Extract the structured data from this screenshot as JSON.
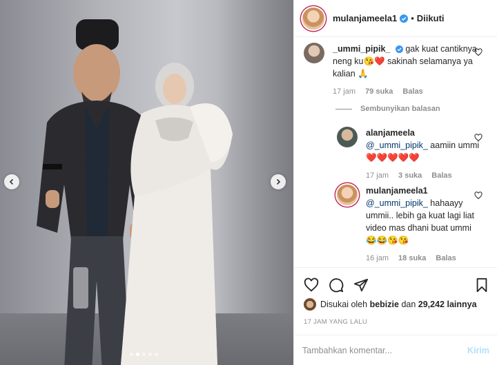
{
  "post": {
    "author": "mulanjameela1",
    "separator": "•",
    "follow_status": "Diikuti"
  },
  "comments": [
    {
      "username": "_ummi_pipik_",
      "text": "gak kuat cantiknya neng ku😘❤️ sakinah selamanya ya kalian 🙏",
      "time": "17 jam",
      "likes": "79 suka",
      "reply": "Balas"
    }
  ],
  "hide_replies": "Sembunyikan balasan",
  "replies": [
    {
      "username": "alanjameela",
      "mention": "@_ummi_pipik_",
      "text": " aamiin ummi ❤️❤️❤️❤️❤️",
      "time": "17 jam",
      "likes": "3 suka",
      "reply": "Balas"
    },
    {
      "username": "mulanjameela1",
      "mention": "@_ummi_pipik_",
      "text": " hahaayy ummii.. lebih ga kuat lagi liat video mas dhani buat ummi 😂😂😘😘",
      "time": "16 jam",
      "likes": "18 suka",
      "reply": "Balas"
    }
  ],
  "likes_summary": {
    "prefix": "Disukai oleh",
    "user": "bebizie",
    "middle": "dan",
    "count": "29,242 lainnya"
  },
  "time_ago": "17 JAM YANG LALU",
  "comment_box": {
    "placeholder": "Tambahkan komentar...",
    "post_label": "Kirim"
  },
  "carousel": {
    "slides": 5,
    "active_index": 1
  },
  "colors": {
    "accent": "#0095f6",
    "heart": "#ed4956",
    "muted": "#8e8e8e",
    "mention": "#00376b"
  },
  "icons": [
    "chevron-left-icon",
    "chevron-right-icon",
    "verified-icon",
    "heart-icon",
    "comment-icon",
    "share-icon",
    "bookmark-icon"
  ]
}
